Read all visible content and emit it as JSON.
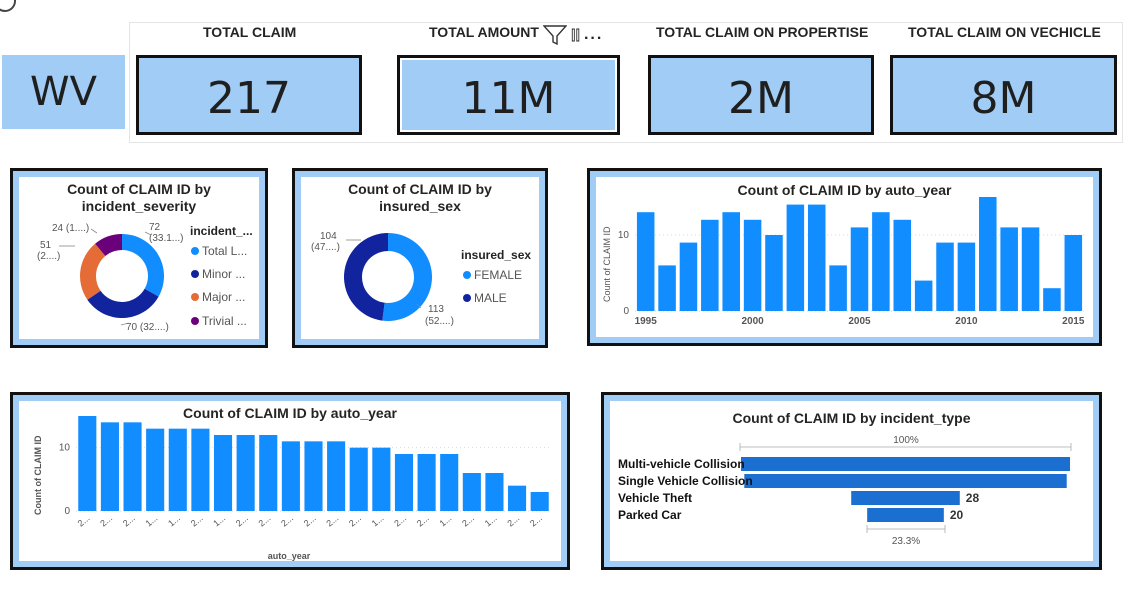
{
  "state": {
    "label": "WV"
  },
  "kpis": [
    {
      "title": "TOTAL CLAIM",
      "value": "217"
    },
    {
      "title": "TOTAL AMOUNT",
      "value": "11M"
    },
    {
      "title": "TOTAL CLAIM ON PROPERTISE",
      "value": "2M"
    },
    {
      "title": "TOTAL CLAIM ON VECHICLE",
      "value": "8M"
    }
  ],
  "visual_header": {
    "focus": "⫿⫿",
    "more": "..."
  },
  "severity_chart": {
    "title_line1": "Count of CLAIM ID by",
    "title_line2": "incident_severity",
    "legend_title": "incident_...",
    "legend": [
      {
        "label": "Total L...",
        "color": "#118DFF"
      },
      {
        "label": "Minor ...",
        "color": "#12239E"
      },
      {
        "label": "Major ...",
        "color": "#E66C37"
      },
      {
        "label": "Trivial ...",
        "color": "#6B007B"
      }
    ],
    "data_labels": [
      "72",
      "(33.1...)",
      "70 (32....)",
      "51",
      "(2....)",
      "24 (1....)"
    ]
  },
  "sex_chart": {
    "title_line1": "Count of CLAIM ID by",
    "title_line2": "insured_sex",
    "legend_title": "insured_sex",
    "legend": [
      {
        "label": "FEMALE",
        "color": "#118DFF"
      },
      {
        "label": "MALE",
        "color": "#12239E"
      }
    ],
    "data_labels": [
      "104",
      "(47....)",
      "113",
      "(52....)"
    ]
  },
  "auto_year_chart": {
    "title": "Count of CLAIM ID by auto_year",
    "ylabel": "Count of CLAIM ID"
  },
  "sorted_year_chart": {
    "title": "Count of CLAIM ID by auto_year",
    "ylabel": "Count of CLAIM ID",
    "xlabel": "auto_year"
  },
  "incident_chart": {
    "title": "Count of CLAIM ID by incident_type",
    "top_pct": "100%",
    "bottom_pct": "23.3%"
  },
  "chart_data": [
    {
      "type": "pie",
      "title": "Count of CLAIM ID by incident_severity",
      "categories": [
        "Total L...",
        "Minor ...",
        "Major ...",
        "Trivial ..."
      ],
      "values": [
        72,
        70,
        51,
        24
      ],
      "colors": [
        "#118DFF",
        "#12239E",
        "#E66C37",
        "#6B007B"
      ],
      "donut": true,
      "legend": "right"
    },
    {
      "type": "pie",
      "title": "Count of CLAIM ID by insured_sex",
      "categories": [
        "FEMALE",
        "MALE"
      ],
      "values": [
        113,
        104
      ],
      "colors": [
        "#118DFF",
        "#12239E"
      ],
      "donut": true,
      "legend": "right"
    },
    {
      "type": "bar",
      "title": "Count of CLAIM ID by auto_year",
      "ylabel": "Count of CLAIM ID",
      "x": [
        1995,
        1996,
        1997,
        1998,
        1999,
        2000,
        2001,
        2002,
        2003,
        2004,
        2005,
        2006,
        2007,
        2008,
        2009,
        2010,
        2011,
        2012,
        2013,
        2014,
        2015
      ],
      "values": [
        13,
        6,
        9,
        12,
        13,
        12,
        10,
        14,
        14,
        6,
        11,
        13,
        12,
        4,
        9,
        9,
        15,
        11,
        11,
        3,
        10
      ],
      "xticks": [
        "1995",
        "2000",
        "2005",
        "2010",
        "2015"
      ],
      "yticks": [
        "0",
        "10"
      ],
      "ylim": [
        0,
        15
      ],
      "grid": true,
      "color": "#118DFF"
    },
    {
      "type": "bar",
      "title": "Count of CLAIM ID by auto_year",
      "ylabel": "Count of CLAIM ID",
      "xlabel": "auto_year",
      "categories": [
        "2...",
        "2...",
        "2...",
        "1...",
        "1...",
        "2...",
        "1...",
        "2...",
        "2...",
        "2...",
        "2...",
        "2...",
        "2...",
        "1...",
        "2...",
        "2...",
        "1...",
        "2...",
        "1...",
        "2...",
        "2..."
      ],
      "values": [
        15,
        14,
        14,
        13,
        13,
        13,
        12,
        12,
        12,
        11,
        11,
        11,
        10,
        10,
        9,
        9,
        9,
        6,
        6,
        4,
        3
      ],
      "yticks": [
        "0",
        "10"
      ],
      "ylim": [
        0,
        15
      ],
      "grid": true,
      "color": "#118DFF"
    },
    {
      "type": "bar",
      "orientation": "funnel",
      "title": "Count of CLAIM ID by incident_type",
      "categories": [
        "Multi-vehicle Collision",
        "Single Vehicle Collision",
        "Vehicle Theft",
        "Parked Car"
      ],
      "values": [
        null,
        null,
        28,
        20
      ],
      "relative_widths": [
        1.0,
        0.98,
        0.33,
        0.233
      ],
      "value_labels": [
        "",
        "",
        "28",
        "20"
      ],
      "color": "#1a6fd1"
    }
  ]
}
